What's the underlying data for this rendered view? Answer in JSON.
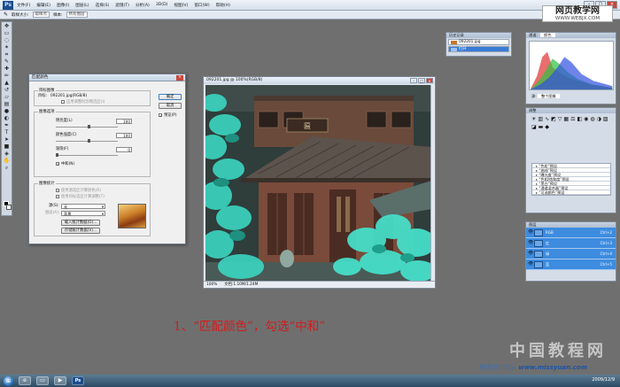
{
  "menubar": {
    "logo": "Ps",
    "items": [
      "文件(F)",
      "编辑(E)",
      "图像(I)",
      "图层(L)",
      "选择(S)",
      "滤镜(T)",
      "分析(A)",
      "3D(D)",
      "视图(V)",
      "窗口(W)",
      "帮助(H)"
    ]
  },
  "options": {
    "sample_size_label": "取样大小:",
    "sample_size_value": "取样点",
    "sample_label": "样本:",
    "sample_value": "所有图层"
  },
  "site_tag": {
    "title": "网页教学网",
    "url": "WWW.WEBJX.COM"
  },
  "dialog": {
    "title": "匹配颜色",
    "target_group": "目标图像",
    "target_label": "目标:",
    "target_value": "092201.jpg(RGB/8)",
    "ignore_selection": "应用调整时忽略选区(I)",
    "options_group": "图像选项",
    "luminance_label": "明亮度(L)",
    "luminance_value": "100",
    "intensity_label": "颜色强度(C)",
    "intensity_value": "100",
    "fade_label": "渐隐(F)",
    "fade_value": "0",
    "neutralize_label": "中和(N)",
    "stats_group": "图像统计",
    "use_sel_source": "使用源选区计算颜色(R)",
    "use_sel_target": "使用目标选区计算调整(T)",
    "source_label": "源(S):",
    "source_value": "无",
    "layer_label": "图层(A):",
    "layer_value": "背景",
    "load_stats": "载入统计数据(O)...",
    "save_stats": "存储统计数据(V)...",
    "ok": "确定",
    "cancel": "取消",
    "preview": "预览(P)"
  },
  "document": {
    "title": "092201.jpg @ 100%(RGB/8)",
    "zoom": "100%",
    "doc_size": "文档:1.10M/1.24M"
  },
  "caption": "1、“匹配颜色”，勾选“中和”",
  "watermark": {
    "main": "中国教程网",
    "footer_prefix": "思缘设计论坛",
    "footer_url": "www.missyuan.com"
  },
  "panels": {
    "history_title": "历史记录",
    "history_items": [
      "092201.jpg",
      "打开"
    ],
    "histogram_title": "通道:",
    "histogram_channel": "颜色",
    "histogram_source_label": "源:",
    "histogram_source": "整个图像",
    "adjustments_title": "调整",
    "adjust_presets": [
      "“色阶”预设",
      "“曲线”预设",
      "“曝光度”预设",
      "“色相/饱和度”预设",
      "“黑白”预设",
      "“通道混合器”预设",
      "“可选颜色”预设"
    ],
    "layers_title": "图层",
    "layers": [
      {
        "name": "RGB",
        "key": "Ctrl+2"
      },
      {
        "name": "红",
        "key": "Ctrl+3"
      },
      {
        "name": "绿",
        "key": "Ctrl+4"
      },
      {
        "name": "蓝",
        "key": "Ctrl+5"
      }
    ]
  },
  "taskbar": {
    "clock": "2009/12/9"
  }
}
